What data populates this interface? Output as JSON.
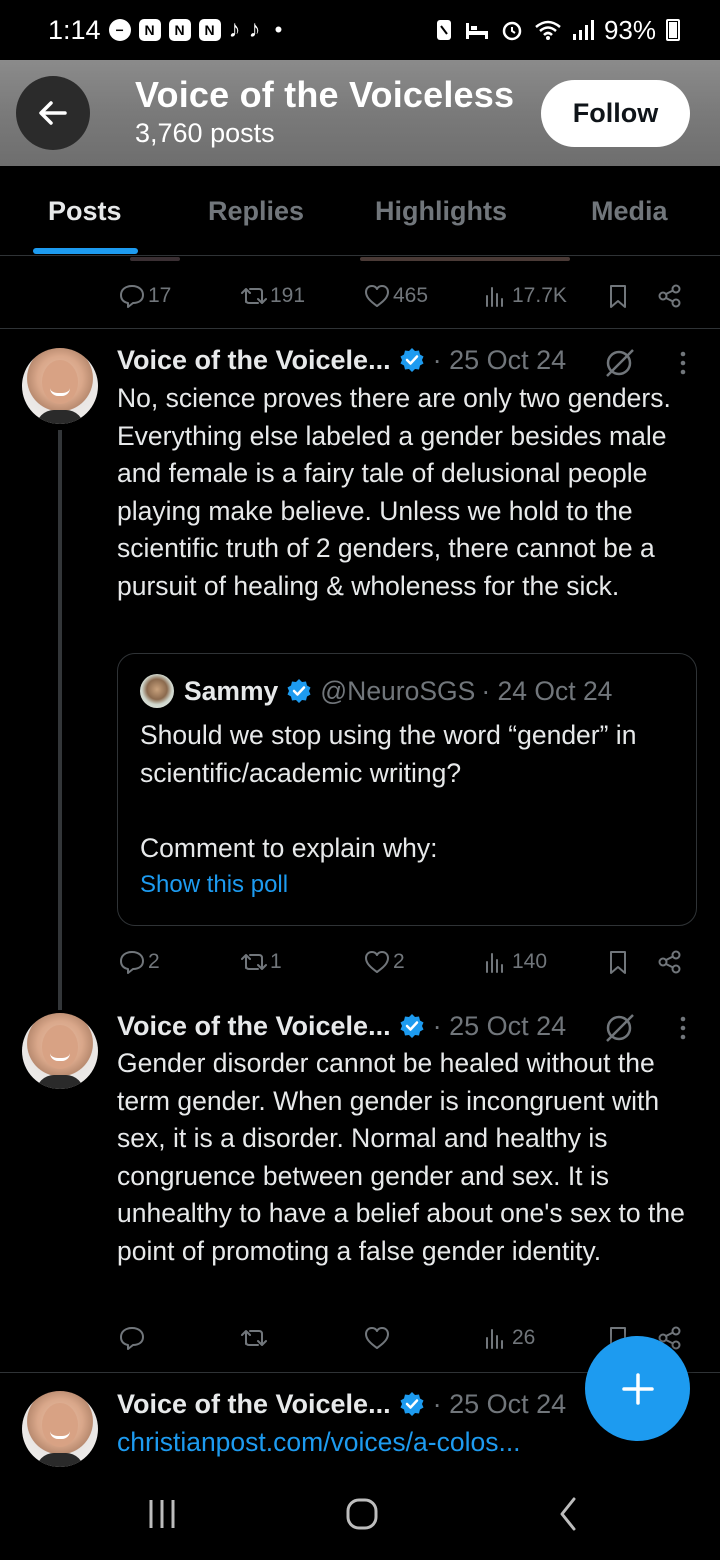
{
  "status_bar": {
    "time": "1:14",
    "notification_icons": [
      "minus-circle-icon",
      "n-app-icon",
      "n-app-icon",
      "n-app-icon",
      "tiktok-icon",
      "tiktok-icon"
    ],
    "dot": "•",
    "battery": "93%"
  },
  "header": {
    "title": "Voice of the Voiceless",
    "subtitle": "3,760 posts",
    "follow_label": "Follow"
  },
  "tabs": [
    {
      "label": "Posts",
      "active": true
    },
    {
      "label": "Replies",
      "active": false
    },
    {
      "label": "Highlights",
      "active": false
    },
    {
      "label": "Media",
      "active": false
    }
  ],
  "prev_actions": {
    "replies": "17",
    "reposts": "191",
    "likes": "465",
    "views": "17.7K"
  },
  "tweets": [
    {
      "name": "Voice of the Voicele...",
      "date": "· 25 Oct 24",
      "body": "No, science proves there are only two genders. Everything else labeled a gender besides male and female is a fairy tale of delusional people playing make believe. Unless we hold to the scientific truth of 2 genders, there cannot be a pursuit of healing & wholeness for the sick.",
      "quote": {
        "name": "Sammy",
        "handle": "@NeuroSGS",
        "date": "· 24 Oct 24",
        "body": "Should we stop using the word “gender” in scientific/academic writing?\n\nComment to explain why:",
        "poll_link": "Show this poll"
      },
      "actions": {
        "replies": "2",
        "reposts": "1",
        "likes": "2",
        "views": "140"
      }
    },
    {
      "name": "Voice of the Voicele...",
      "date": "· 25 Oct 24",
      "body": "Gender disorder cannot be healed without the term gender. When gender is incongruent with sex, it is a disorder. Normal and healthy is congruence between gender and sex. It is unhealthy to have a belief about one's sex to the point of promoting a false gender identity.",
      "actions": {
        "replies": "",
        "reposts": "",
        "likes": "",
        "views": "26"
      }
    },
    {
      "name": "Voice of the Voicele...",
      "date": "· 25 Oct 24",
      "link": "christianpost.com/voices/a-colos..."
    }
  ],
  "colors": {
    "accent": "#1d9bf0",
    "muted": "#71767b",
    "text": "#e7e9ea",
    "divider": "#2f3336"
  }
}
